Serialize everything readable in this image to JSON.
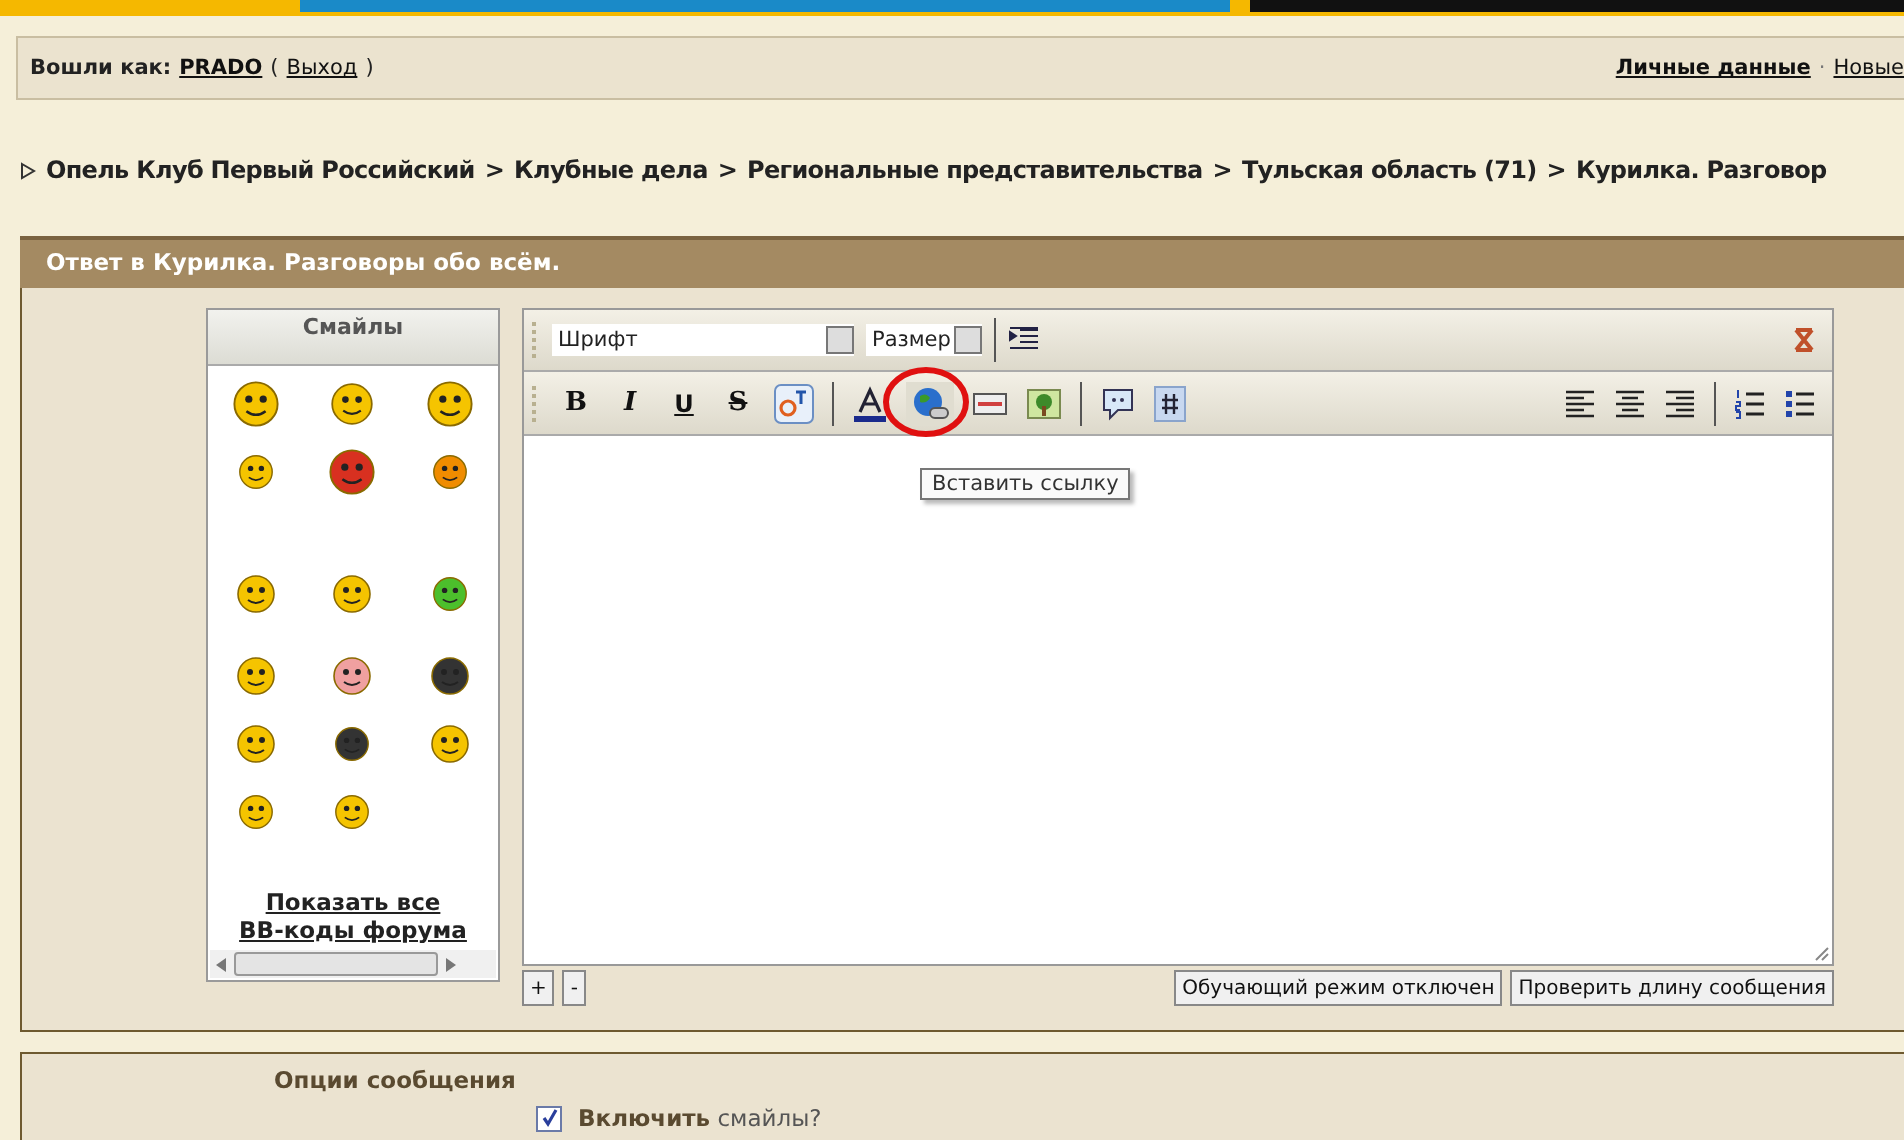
{
  "user_bar": {
    "label": "Вошли как:",
    "username": "PRADO",
    "paren_open": "(",
    "logout": "Выход",
    "paren_close": ")",
    "links": [
      "Личные данные",
      "Новые"
    ],
    "separator": "·"
  },
  "breadcrumb": {
    "separator": ">",
    "items": [
      "Опель Клуб Первый Российский",
      "Клубные дела",
      "Региональные представительства",
      "Тульская область (71)",
      "Курилка. Разговор"
    ]
  },
  "reply_header": "Ответ в Курилка. Разговоры обо всём.",
  "smilies": {
    "title": "Смайлы",
    "show_all": "Показать все",
    "bbcodes": "BB-коды форума"
  },
  "editor": {
    "font": "Шрифт",
    "size": "Размер",
    "format_buttons": [
      "B",
      "I",
      "U",
      "S"
    ],
    "tooltip": "Вставить ссылку"
  },
  "resize_buttons": [
    "+",
    "-"
  ],
  "action_buttons": [
    "Обучающий режим отключен",
    "Проверить длину сообщения"
  ],
  "options": {
    "title": "Опции сообщения",
    "checkbox_label": "**Включить** смайлы?",
    "checked": true
  }
}
